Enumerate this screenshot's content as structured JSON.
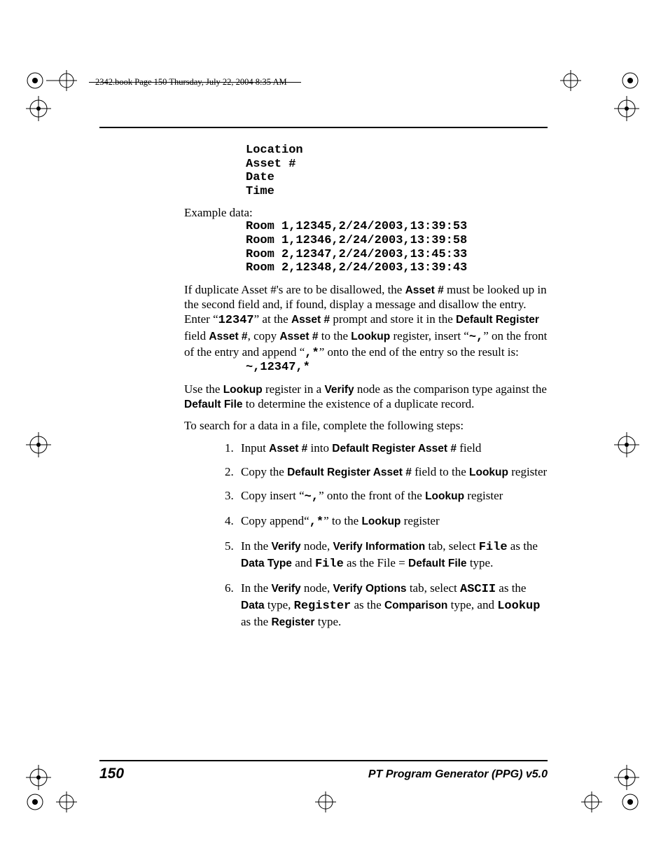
{
  "header": "2342.book  Page 150  Thursday, July 22, 2004  8:35 AM",
  "field_list": "Location\nAsset #\nDate\nTime",
  "example_label": "Example data:",
  "example_data": "Room 1,12345,2/24/2003,13:39:53\nRoom 1,12346,2/24/2003,13:39:58\nRoom 2,12347,2/24/2003,13:45:33\nRoom 2,12348,2/24/2003,13:39:43",
  "p1": {
    "a": "If duplicate Asset #'s are to be disallowed, the ",
    "b": "Asset #",
    "c": " must be looked up in the second field and, if found, display a message and disallow the entry. Enter “",
    "d": "12347",
    "e": "” at the ",
    "f": "Asset #",
    "g": " prompt and store it in the ",
    "h": "Default Register",
    "i": " field ",
    "j": "Asset #",
    "k": ", copy ",
    "l": "Asset #",
    "m": " to the ",
    "n": "Lookup",
    "o": " register, insert “",
    "p": "~,",
    "q": "” on the front of the entry and append “",
    "r": ",*",
    "s": "” onto the end of the entry so the result is:"
  },
  "result_code": "~,12347,*",
  "p2": {
    "a": "Use the ",
    "b": "Lookup",
    "c": " register in a ",
    "d": "Verify",
    "e": " node as the comparison type against the ",
    "f": "Default File",
    "g": " to determine the existence of a duplicate record."
  },
  "p3": "To search for a data in a file, complete the following steps:",
  "steps": {
    "s1": {
      "a": "Input ",
      "b": "Asset #",
      "c": " into ",
      "d": "Default Register Asset #",
      "e": " field"
    },
    "s2": {
      "a": "Copy the ",
      "b": "Default Register Asset #",
      "c": " field to the ",
      "d": "Lookup",
      "e": " register"
    },
    "s3": {
      "a": "Copy insert “",
      "b": "~,",
      "c": "” onto the front of the ",
      "d": "Lookup",
      "e": " register"
    },
    "s4": {
      "a": "Copy append“",
      "b": ",*",
      "c": "” to the ",
      "d": "Lookup",
      "e": " register"
    },
    "s5": {
      "a": "In the ",
      "b": "Verify",
      "c": " node, ",
      "d": "Verify Information",
      "e": " tab, select ",
      "f": "File",
      "g": " as the ",
      "h": "Data Type",
      "i": " and ",
      "j": "File",
      "k": " as the File = ",
      "l": "Default File",
      "m": " type."
    },
    "s6": {
      "a": "In the ",
      "b": "Verify",
      "c": " node, ",
      "d": "Verify Options",
      "e": " tab, select ",
      "f": "ASCII",
      "g": " as the ",
      "h": "Data",
      "i": " type, ",
      "j": "Register",
      "k": " as the ",
      "l": "Comparison",
      "m": " type, and ",
      "n": "Lookup",
      "o": " as the ",
      "p": "Register",
      "q": " type."
    }
  },
  "page_number": "150",
  "footer_title": "PT Program Generator (PPG)  v5.0"
}
